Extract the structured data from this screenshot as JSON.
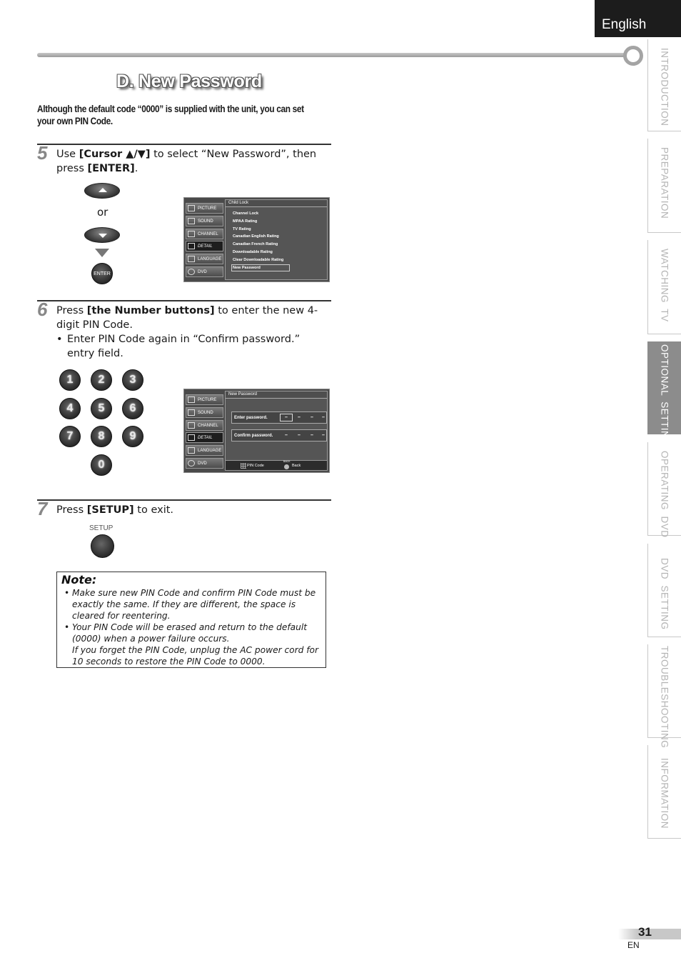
{
  "header": {
    "language": "English"
  },
  "side_tabs": [
    {
      "label": "INTRODUCTION",
      "active": false
    },
    {
      "label": "PREPARATION",
      "active": false
    },
    {
      "label": "WATCHING  TV",
      "active": false
    },
    {
      "label": "OPTIONAL  SETTING",
      "active": true
    },
    {
      "label": "OPERATING  DVD",
      "active": false
    },
    {
      "label": "DVD  SETTING",
      "active": false
    },
    {
      "label": "TROUBLESHOOTING",
      "active": false
    },
    {
      "label": "INFORMATION",
      "active": false
    }
  ],
  "section": {
    "title": "D. New Password",
    "intro": "Although the default code “0000” is supplied with the unit, you can set your own PIN Code."
  },
  "steps": [
    {
      "number": "5",
      "text_prefix": "Use ",
      "bold1": "[Cursor ▲/▼]",
      "text_mid": " to select “New Password”, then press ",
      "bold2": "[ENTER]",
      "text_suffix": "."
    },
    {
      "number": "6",
      "text_prefix": "Press ",
      "bold1": "[the Number buttons]",
      "text_suffix": " to enter the new 4-digit PIN Code.",
      "bullet": "Enter PIN Code again in “Confirm password.” entry field."
    },
    {
      "number": "7",
      "text_prefix": "Press ",
      "bold1": "[SETUP]",
      "text_suffix": " to exit."
    }
  ],
  "remote": {
    "or_label": "or",
    "enter_label": "ENTER",
    "setup_label": "SETUP",
    "number_buttons": [
      "1",
      "2",
      "3",
      "4",
      "5",
      "6",
      "7",
      "8",
      "9",
      "0"
    ]
  },
  "tv_menu": {
    "sidebar": [
      "PICTURE",
      "SOUND",
      "CHANNEL",
      "DETAIL",
      "LANGUAGE",
      "DVD"
    ],
    "selected": "DETAIL",
    "child_lock": {
      "title": "Child Lock",
      "items": [
        "Channel Lock",
        "MPAA Rating",
        "TV Rating",
        "Canadian English Rating",
        "Canadian French Rating",
        "Downloadable Rating",
        "Clear Downloadable Rating",
        "New Password"
      ],
      "highlighted": "New Password"
    },
    "new_password": {
      "title": "New Password",
      "enter_label": "Enter password.",
      "confirm_label": "Confirm password.",
      "dash": "–",
      "footer_pin": "PIN Code",
      "footer_back_small": "BACK",
      "footer_back": "Back"
    }
  },
  "note": {
    "title": "Note:",
    "items": [
      "Make sure new PIN Code and confirm PIN Code must be exactly the same. If they are different, the space is cleared for reentering.",
      "Your PIN Code will be erased and return to the default (0000) when a power failure occurs."
    ],
    "continuation": "If you forget the PIN Code, unplug the AC power cord for 10 seconds to restore the PIN Code to 0000."
  },
  "footer": {
    "page_number": "31",
    "page_lang": "EN"
  }
}
